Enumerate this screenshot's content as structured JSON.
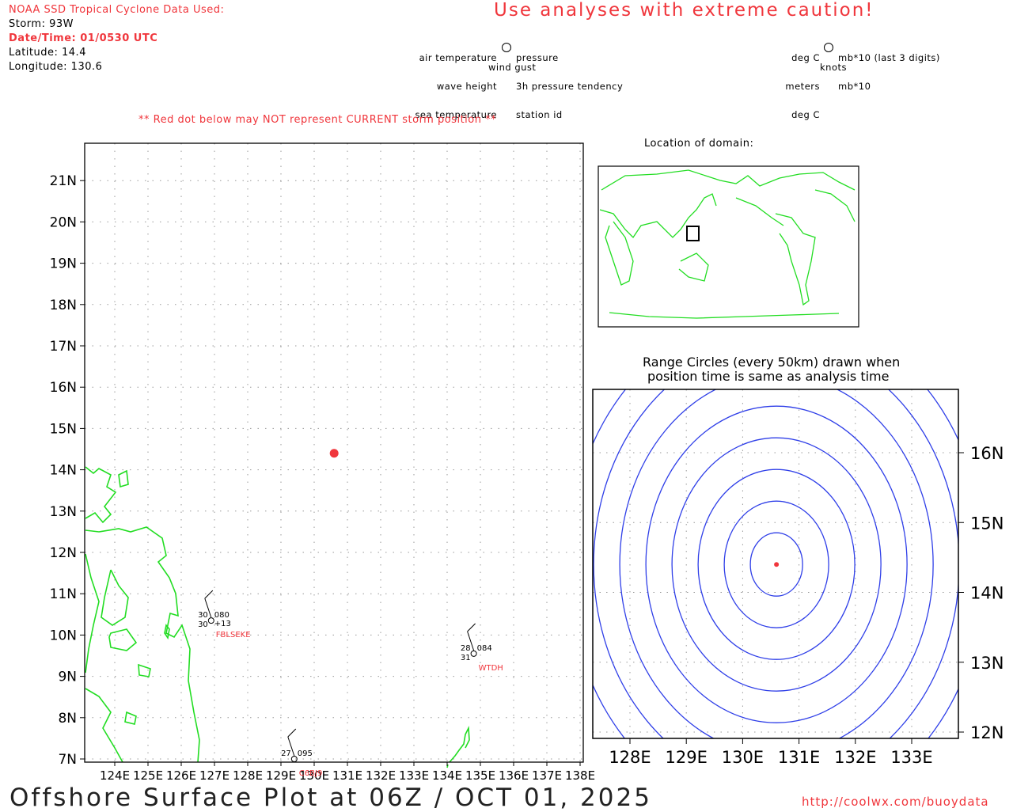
{
  "header": {
    "source_title": "NOAA SSD Tropical Cyclone Data Used:",
    "storm": "Storm: 93W",
    "datetime": "Date/Time: 01/0530 UTC",
    "latitude": "Latitude: 14.4",
    "longitude": "Longitude: 130.6",
    "caution": "Use analyses with extreme caution!",
    "red_dot_note": "** Red dot below may NOT represent CURRENT storm position **"
  },
  "legend": {
    "left": [
      "air temperature",
      "wave height",
      "sea temperature"
    ],
    "right": [
      "pressure",
      "3h pressure tendency",
      "station id"
    ],
    "bottom": "wind gust",
    "units_left": [
      "deg C",
      "meters",
      "deg C"
    ],
    "units_right": [
      "mb*10 (last 3 digits)",
      "mb*10"
    ],
    "units_bottom": "knots"
  },
  "main_map": {
    "lat_labels": [
      "7N",
      "8N",
      "9N",
      "10N",
      "11N",
      "12N",
      "13N",
      "14N",
      "15N",
      "16N",
      "17N",
      "18N",
      "19N",
      "20N",
      "21N"
    ],
    "lat_values": [
      7,
      8,
      9,
      10,
      11,
      12,
      13,
      14,
      15,
      16,
      17,
      18,
      19,
      20,
      21
    ],
    "lon_labels": [
      "124E",
      "125E",
      "126E",
      "127E",
      "128E",
      "129E",
      "130E",
      "131E",
      "132E",
      "133E",
      "134E",
      "135E",
      "136E",
      "137E",
      "138E"
    ],
    "lon_values": [
      124,
      125,
      126,
      127,
      128,
      129,
      130,
      131,
      132,
      133,
      134,
      135,
      136,
      137,
      138
    ],
    "storm_position": {
      "lat": 14.4,
      "lon": 130.6
    },
    "stations": [
      {
        "id": "FBLSEKE",
        "lat": 10.35,
        "lon": 126.9,
        "air_temp": "30",
        "sea_temp": "30",
        "pressure": "080",
        "tendency": "+13"
      },
      {
        "id": "WTDH",
        "lat": 9.55,
        "lon": 134.8,
        "air_temp": "28",
        "sea_temp": "31",
        "pressure": "084",
        "tendency": ""
      },
      {
        "id": "C6BJ9",
        "lat": 7.0,
        "lon": 129.4,
        "air_temp": "27",
        "sea_temp": "",
        "pressure": "095",
        "tendency": ""
      }
    ]
  },
  "inset": {
    "title": "Location of domain:"
  },
  "range": {
    "title_line1": "Range Circles (every 50km) drawn when",
    "title_line2": "position time is same as analysis time",
    "lat_labels": [
      "12N",
      "13N",
      "14N",
      "15N",
      "16N"
    ],
    "lat_values": [
      12,
      13,
      14,
      15,
      16
    ],
    "lon_labels": [
      "128E",
      "129E",
      "130E",
      "131E",
      "132E",
      "133E"
    ],
    "lon_values": [
      128,
      129,
      130,
      131,
      132,
      133
    ],
    "circle_count": 9,
    "circle_step_km": 50
  },
  "footer": {
    "title": "Offshore Surface Plot at 06Z / OCT 01, 2025",
    "url": "http://coolwx.com/buoydata"
  },
  "colors": {
    "red": "#f0363c",
    "coast": "#22dd22",
    "circles": "#2f3fe8"
  }
}
